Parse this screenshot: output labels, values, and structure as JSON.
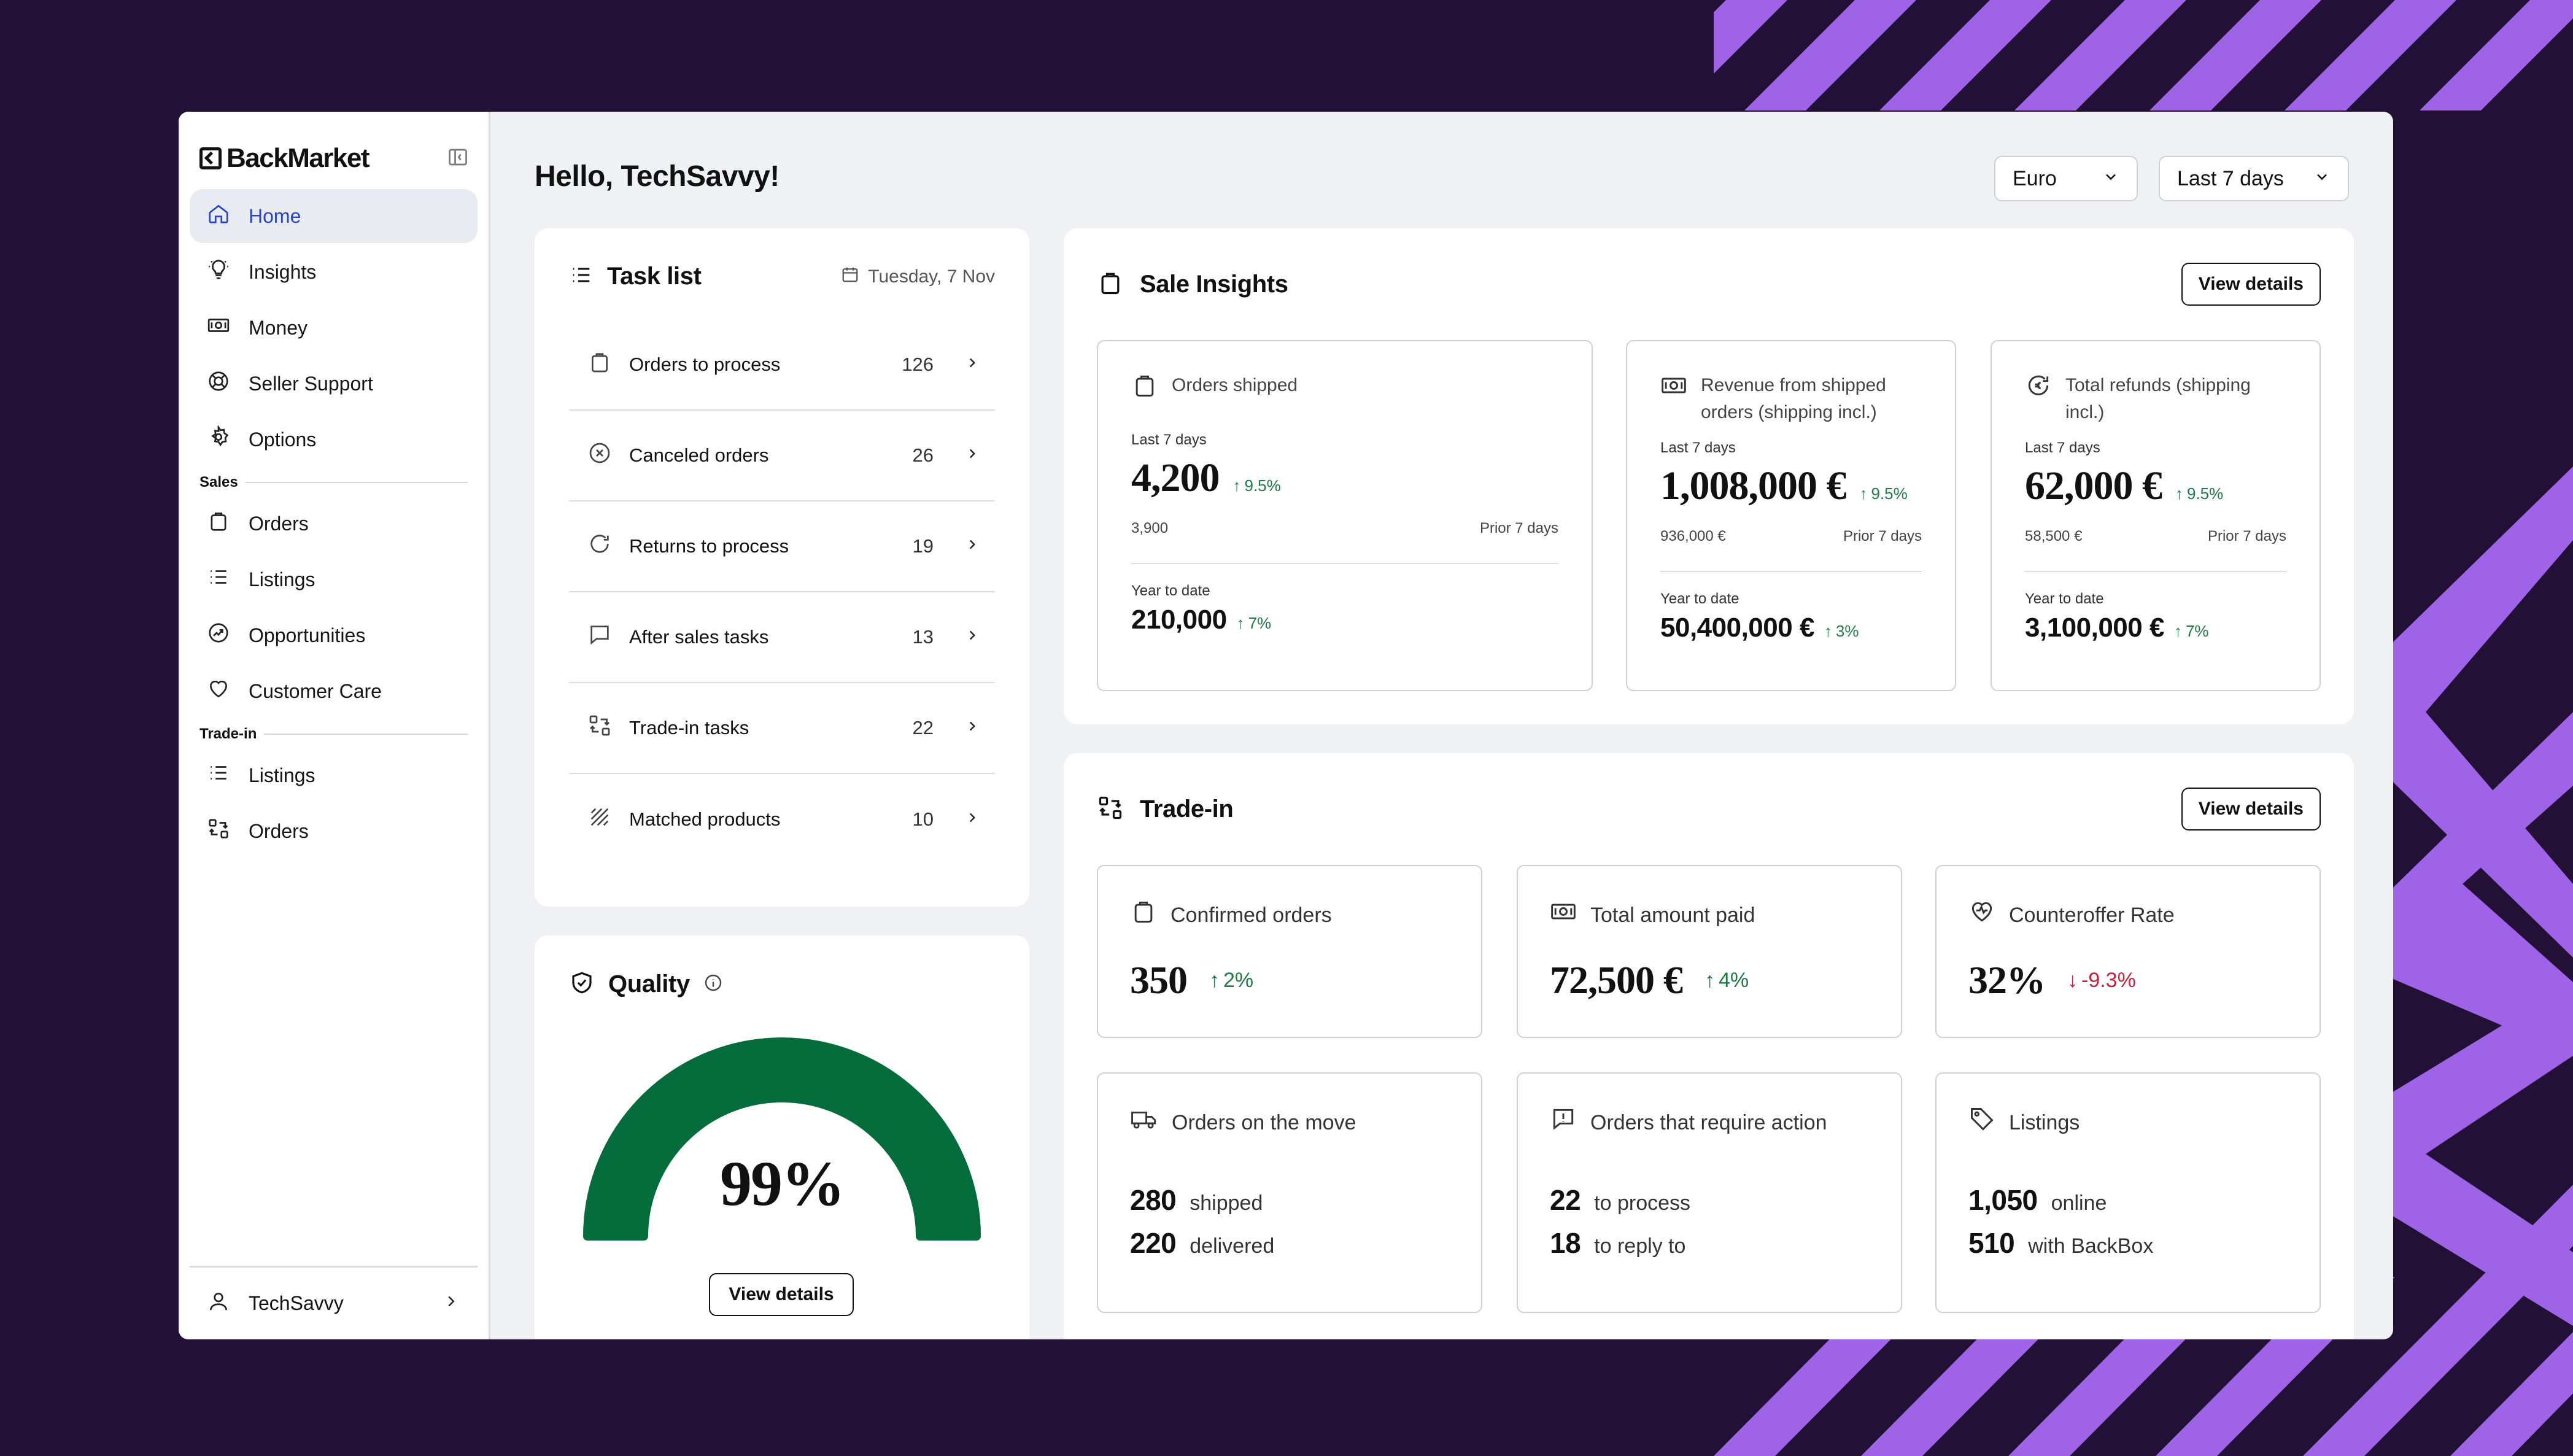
{
  "brand": {
    "name": "BackMarket"
  },
  "sidebar": {
    "items": [
      {
        "label": "Home",
        "icon": "home-icon",
        "active": true
      },
      {
        "label": "Insights",
        "icon": "lightbulb-icon"
      },
      {
        "label": "Money",
        "icon": "banknote-icon"
      },
      {
        "label": "Seller Support",
        "icon": "lifebuoy-icon"
      },
      {
        "label": "Options",
        "icon": "gear-icon"
      }
    ],
    "sales_title": "Sales",
    "sales_items": [
      {
        "label": "Orders",
        "icon": "bag-icon"
      },
      {
        "label": "Listings",
        "icon": "list-icon"
      },
      {
        "label": "Opportunities",
        "icon": "trend-icon"
      },
      {
        "label": "Customer Care",
        "icon": "heart-icon"
      }
    ],
    "tradein_title": "Trade-in",
    "tradein_items": [
      {
        "label": "Listings",
        "icon": "list-icon"
      },
      {
        "label": "Orders",
        "icon": "swap-icon"
      }
    ],
    "user": "TechSavvy"
  },
  "header": {
    "greeting": "Hello, TechSavvy!",
    "currency": "Euro",
    "period": "Last 7 days"
  },
  "tasks": {
    "title": "Task list",
    "date": "Tuesday, 7 Nov",
    "rows": [
      {
        "label": "Orders to process",
        "count": "126",
        "icon": "bag-icon"
      },
      {
        "label": "Canceled orders",
        "count": "26",
        "icon": "x-circle-icon"
      },
      {
        "label": "Returns to process",
        "count": "19",
        "icon": "refresh-icon"
      },
      {
        "label": "After sales tasks",
        "count": "13",
        "icon": "chat-bubble-icon"
      },
      {
        "label": "Trade-in tasks",
        "count": "22",
        "icon": "swap-icon"
      },
      {
        "label": "Matched products",
        "count": "10",
        "icon": "hatch-icon"
      }
    ]
  },
  "quality": {
    "title": "Quality",
    "value": "99%",
    "fraction": 0.99,
    "button": "View details",
    "color": "#046b3a"
  },
  "sale_insights": {
    "title": "Sale Insights",
    "button": "View details",
    "cards": [
      {
        "title": "Orders shipped",
        "icon": "bag-icon",
        "period": "Last 7 days",
        "value": "4,200",
        "delta": "9.5%",
        "prior_value": "3,900",
        "prior_label": "Prior 7 days",
        "ytd_label": "Year to date",
        "ytd_value": "210,000",
        "ytd_delta": "7%"
      },
      {
        "title": "Revenue from shipped orders (shipping incl.)",
        "icon": "banknote-icon",
        "period": "Last 7 days",
        "value": "1,008,000 €",
        "delta": "9.5%",
        "prior_value": "936,000 €",
        "prior_label": "Prior 7 days",
        "ytd_label": "Year to date",
        "ytd_value": "50,400,000 €",
        "ytd_delta": "3%"
      },
      {
        "title": "Total refunds (shipping incl.)",
        "icon": "refund-icon",
        "period": "Last 7 days",
        "value": "62,000 €",
        "delta": "9.5%",
        "prior_value": "58,500 €",
        "prior_label": "Prior 7 days",
        "ytd_label": "Year to date",
        "ytd_value": "3,100,000 €",
        "ytd_delta": "7%"
      }
    ]
  },
  "trade_in": {
    "title": "Trade-in",
    "button": "View details",
    "cards": [
      {
        "title": "Confirmed orders",
        "icon": "bag-icon",
        "value": "350",
        "delta": "2%",
        "direction": "up"
      },
      {
        "title": "Total amount paid",
        "icon": "banknote-icon",
        "value": "72,500 €",
        "delta": "4%",
        "direction": "up"
      },
      {
        "title": "Counteroffer Rate",
        "icon": "heart-pulse-icon",
        "value": "32%",
        "delta": "-9.3%",
        "direction": "down"
      }
    ],
    "stats": [
      {
        "title": "Orders on the move",
        "icon": "truck-icon",
        "lines": [
          {
            "n": "280",
            "label": "shipped"
          },
          {
            "n": "220",
            "label": "delivered"
          }
        ]
      },
      {
        "title": "Orders that require action",
        "icon": "alert-bubble-icon",
        "lines": [
          {
            "n": "22",
            "label": "to process"
          },
          {
            "n": "18",
            "label": "to reply to"
          }
        ]
      },
      {
        "title": "Listings",
        "icon": "tag-icon",
        "lines": [
          {
            "n": "1,050",
            "label": "online"
          },
          {
            "n": "510",
            "label": "with BackBox"
          }
        ]
      }
    ]
  },
  "colors": {
    "up": "#1f7a45",
    "down": "#c52240",
    "accent": "#2a44c2",
    "stripe": "#9e63e6",
    "background": "#231036"
  }
}
